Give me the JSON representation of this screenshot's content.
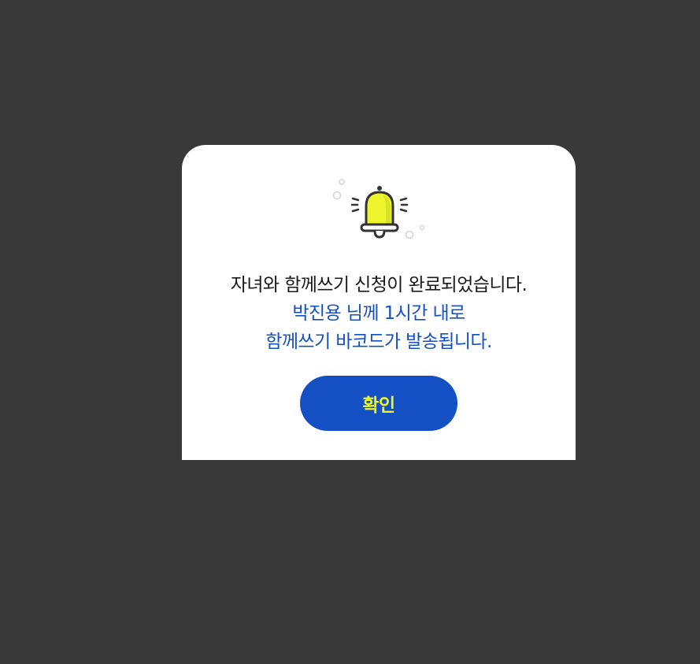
{
  "dialog": {
    "icon": "bell-icon",
    "message_line1": "자녀와 함께쓰기 신청이 완료되었습니다.",
    "message_line2": "박진용 님께 1시간 내로",
    "message_line3": "함께쓰기 바코드가 발송됩니다.",
    "confirm_label": "확인"
  },
  "colors": {
    "overlay": "#393939",
    "dialog_bg": "#ffffff",
    "primary_text": "#1a1a1a",
    "accent_blue": "#1450c4",
    "button_text": "#ecf42c",
    "bell_fill": "#ecf42c",
    "bell_outline": "#333333"
  }
}
